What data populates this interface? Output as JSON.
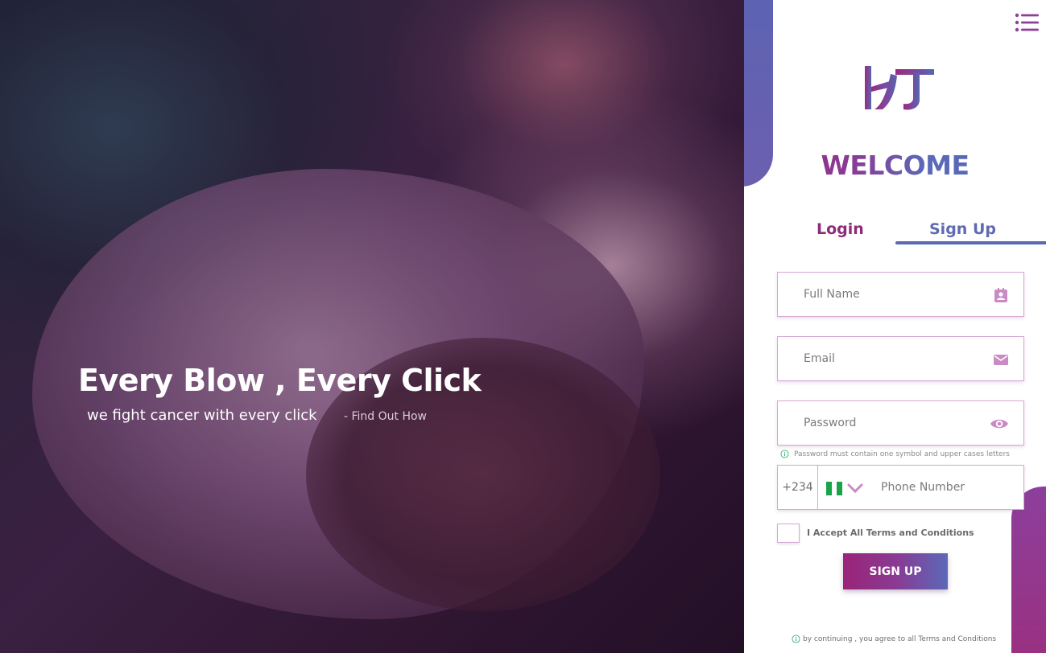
{
  "hero": {
    "title": "Every Blow , Every Click",
    "subtitle": "we fight cancer with every click",
    "link": "- Find Out How"
  },
  "brand": {
    "logo_text": "HT",
    "welcome": "WELCOME"
  },
  "tabs": [
    {
      "label": "Login",
      "active": false
    },
    {
      "label": "Sign Up",
      "active": true
    }
  ],
  "form": {
    "full_name": {
      "placeholder": "Full Name",
      "value": "",
      "icon": "contact-card-icon"
    },
    "email": {
      "placeholder": "Email",
      "value": "",
      "icon": "mail-icon"
    },
    "password": {
      "placeholder": "Password",
      "value": "",
      "icon": "eye-icon"
    },
    "password_hint": "Password must contain one symbol and upper cases letters",
    "phone": {
      "country_code": "+234",
      "country": "Nigeria",
      "placeholder": "Phone Number",
      "value": ""
    },
    "terms_label": "I Accept All Terms and Conditions",
    "terms_checked": false,
    "submit_label": "SIGN UP",
    "footer_note": "by continuing , you agree to all Terms and Conditions"
  },
  "colors": {
    "primary_purple": "#8e2b77",
    "primary_blue": "#5b68b2",
    "field_border": "#d8a6d3",
    "icon_pink": "#c98bc4"
  }
}
